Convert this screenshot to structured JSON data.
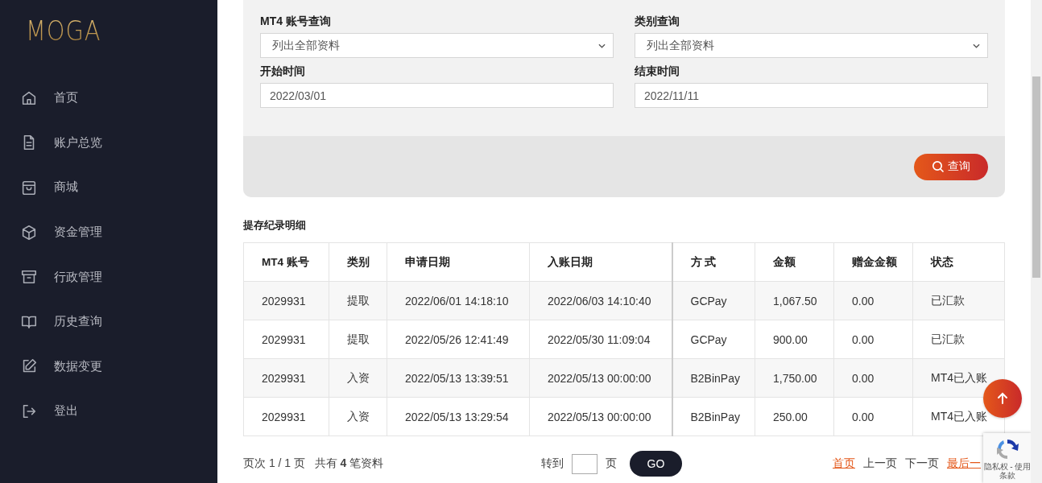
{
  "sidebar": {
    "logo": "MOGA",
    "items": [
      {
        "label": "首页"
      },
      {
        "label": "账户总览"
      },
      {
        "label": "商城"
      },
      {
        "label": "资金管理"
      },
      {
        "label": "行政管理"
      },
      {
        "label": "历史查询"
      },
      {
        "label": "数据变更"
      },
      {
        "label": "登出"
      }
    ]
  },
  "filters": {
    "fields": [
      {
        "label": "MT4 账号查询",
        "kind": "select",
        "value": "列出全部资料"
      },
      {
        "label": "类别查询",
        "kind": "select",
        "value": "列出全部资料"
      },
      {
        "label": "开始时间",
        "kind": "text",
        "value": "2022/03/01"
      },
      {
        "label": "结束时间",
        "kind": "text",
        "value": "2022/11/11"
      }
    ],
    "search_button": "查询"
  },
  "table": {
    "title": "提存纪录明细",
    "columns": [
      "MT4 账号",
      "类别",
      "申请日期",
      "入账日期",
      "方 式",
      "金额",
      "赠金金额",
      "状态"
    ],
    "rows": [
      [
        "2029931",
        "提取",
        "2022/06/01 14:18:10",
        "2022/06/03 14:10:40",
        "GCPay",
        "1,067.50",
        "0.00",
        "已汇款"
      ],
      [
        "2029931",
        "提取",
        "2022/05/26 12:41:49",
        "2022/05/30 11:09:04",
        "GCPay",
        "900.00",
        "0.00",
        "已汇款"
      ],
      [
        "2029931",
        "入资",
        "2022/05/13 13:39:51",
        "2022/05/13 00:00:00",
        "B2BinPay",
        "1,750.00",
        "0.00",
        "MT4已入账"
      ],
      [
        "2029931",
        "入资",
        "2022/05/13 13:29:54",
        "2022/05/13 00:00:00",
        "B2BinPay",
        "250.00",
        "0.00",
        "MT4已入账"
      ]
    ]
  },
  "pagination": {
    "summary": "页次 1 / 1 页   共有 **4** 笔资料",
    "goto_label": "转到",
    "page_unit": "页",
    "go_button": "GO",
    "links": [
      {
        "label": "首页",
        "highlighted": true
      },
      {
        "label": "上一页",
        "highlighted": false
      },
      {
        "label": "下一页",
        "highlighted": false
      },
      {
        "label": "最后一",
        "highlighted": true
      }
    ]
  },
  "recaptcha": {
    "text": "隐私权 - 使用条款"
  }
}
